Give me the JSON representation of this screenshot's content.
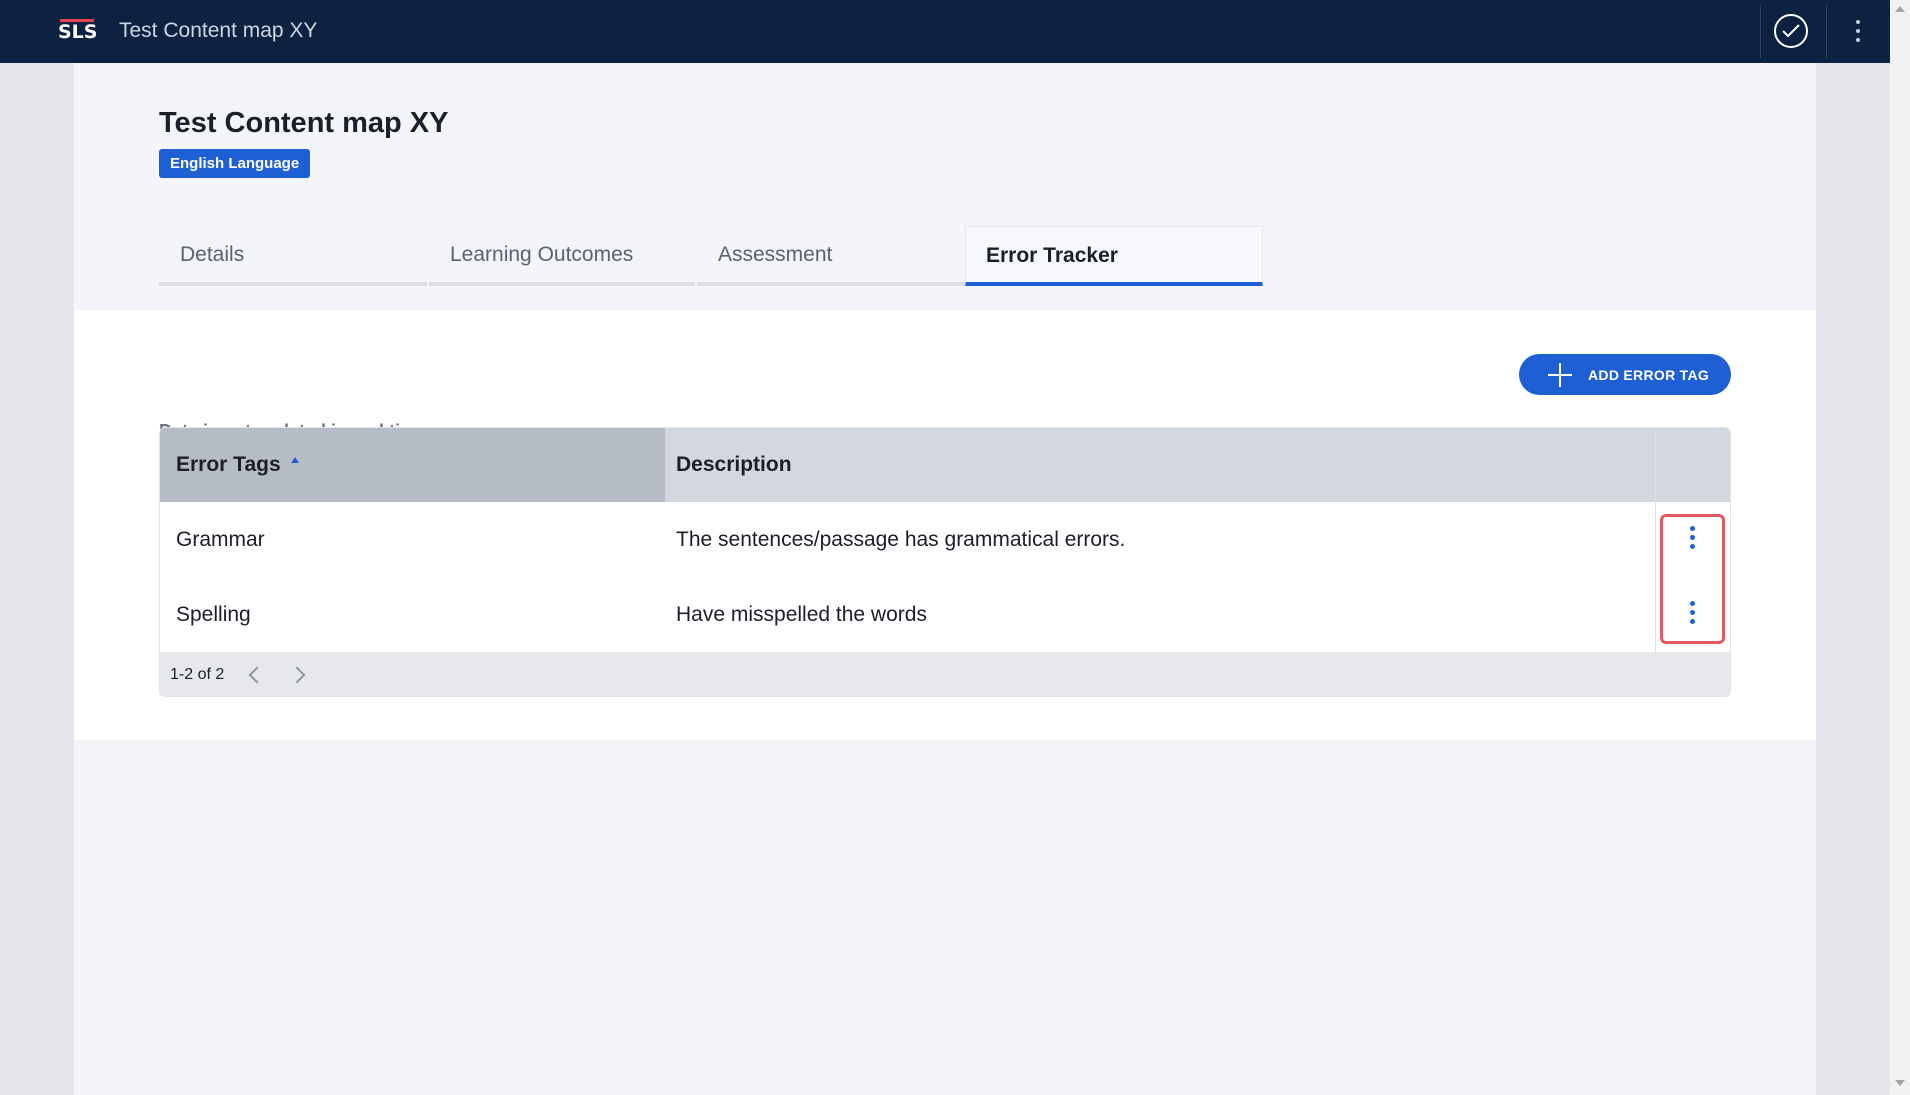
{
  "topbar": {
    "logo_text": "SLS",
    "title": "Test Content map XY",
    "check_icon": "check-circle-icon",
    "more_icon": "more-vertical-icon"
  },
  "header": {
    "title": "Test Content map XY",
    "badge": "English Language"
  },
  "tabs": [
    {
      "label": "Details",
      "active": false
    },
    {
      "label": "Learning Outcomes",
      "active": false
    },
    {
      "label": "Assessment",
      "active": false
    },
    {
      "label": "Error Tracker",
      "active": true
    }
  ],
  "content": {
    "info_text": "Data is not updated in real time",
    "add_button_label": "ADD ERROR TAG"
  },
  "table": {
    "columns": [
      "Error Tags",
      "Description"
    ],
    "sort_column": "Error Tags",
    "sort_direction": "ascending",
    "rows": [
      {
        "tag": "Grammar",
        "description": "The sentences/passage has grammatical errors."
      },
      {
        "tag": "Spelling",
        "description": "Have misspelled the words"
      }
    ],
    "pagination": "1-2 of 2"
  },
  "colors": {
    "topbar": "#0c2240",
    "accent": "#1f5fd4",
    "highlight": "#e05a60"
  }
}
